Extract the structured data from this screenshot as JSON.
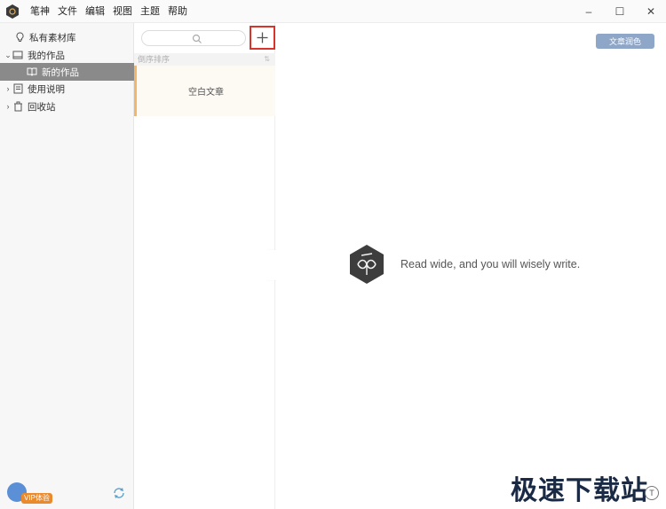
{
  "titlebar": {
    "menu": [
      "笔神",
      "文件",
      "编辑",
      "视图",
      "主题",
      "帮助"
    ],
    "window_controls": {
      "minimize": "–",
      "maximize": "☐",
      "close": "✕"
    }
  },
  "sidebar": {
    "items": [
      {
        "label": "私有素材库",
        "icon": "bulb-icon"
      },
      {
        "label": "我的作品",
        "icon": "book-icon",
        "expanded": true
      },
      {
        "label": "新的作品",
        "icon": "open-book-icon",
        "selected": true
      },
      {
        "label": "使用说明",
        "icon": "doc-icon"
      },
      {
        "label": "回收站",
        "icon": "trash-icon"
      }
    ],
    "vip_label": "VIP体验"
  },
  "listpane": {
    "search_placeholder": "",
    "sort_label": "倒序排序",
    "sort_toggle": "⇅",
    "articles": [
      {
        "title": "空白文章"
      }
    ]
  },
  "editor": {
    "polish_button": "文章润色",
    "tagline": "Read wide, and you will wisely write."
  },
  "watermark": {
    "text": "极速下载站",
    "badge": "T"
  },
  "colors": {
    "accent_add": "#d9342b",
    "selected_bg": "#8a8a8a",
    "polish_btn": "#8ea7c9",
    "article_marker": "#f0b66a"
  }
}
